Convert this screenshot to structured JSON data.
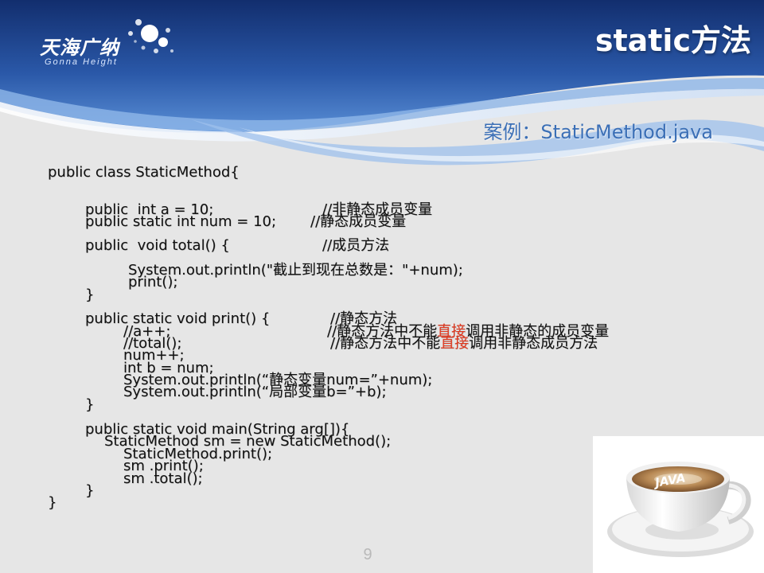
{
  "header": {
    "logo_cn": "天海广纳",
    "logo_en": "Gonna Height",
    "title": "static方法"
  },
  "subtitle": "案例：StaticMethod.java",
  "code": {
    "l1": "public class StaticMethod{",
    "l2": "public  int a = 10;",
    "l2c": "//非静态成员变量",
    "l3": "public static int num = 10;",
    "l3c": "//静态成员变量",
    "l4": "public  void total() {",
    "l4c": "//成员方法",
    "l5": "System.out.println(\"截止到现在总数是：\"+num);",
    "l6": "print();",
    "l7": "}",
    "l8": "public static void print() {",
    "l8c": "//静态方法",
    "l9": "//a++;",
    "l9c_a": "//静态方法中不能",
    "l9c_b": "直接",
    "l9c_c": "调用非静态的成员变量",
    "l10": "//total();",
    "l10c_a": "//静态方法中不能",
    "l10c_b": "直接",
    "l10c_c": "调用非静态成员方法",
    "l11": "num++;",
    "l12": "int b = num;",
    "l13": "System.out.println(“静态变量num=”+num);",
    "l14": "System.out.println(“局部变量b=”+b);",
    "l15": "}",
    "l16": "public static void main(String arg[]){",
    "l17": "StaticMethod sm = new StaticMethod();",
    "l18": "StaticMethod.print();",
    "l19": "sm .print();",
    "l20": "sm .total();",
    "l21": "}",
    "l22": "}"
  },
  "photo": {
    "cup_text": "JAVA"
  },
  "page_number": "9",
  "colors": {
    "banner_dark": "#1d3f86",
    "banner_mid": "#3a6cc0",
    "subtitle": "#3b6fb6",
    "highlight": "#e2381e",
    "background": "#e6e6e6"
  }
}
